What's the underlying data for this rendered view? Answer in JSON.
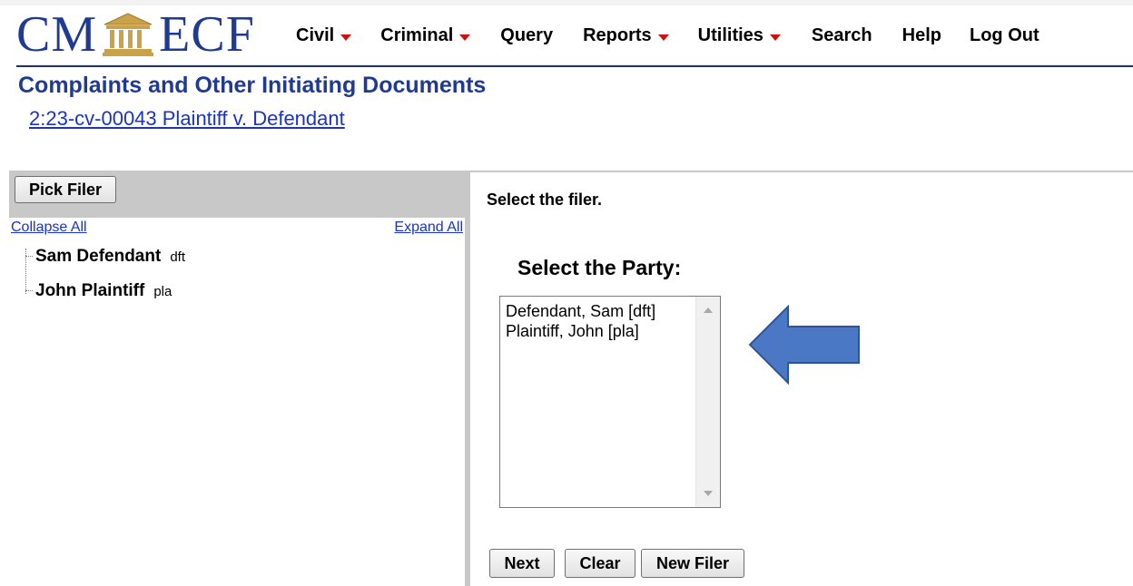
{
  "header": {
    "logo_left": "CM",
    "logo_right": "ECF",
    "menu": [
      {
        "label": "Civil",
        "has_dropdown": true
      },
      {
        "label": "Criminal",
        "has_dropdown": true
      },
      {
        "label": "Query",
        "has_dropdown": false
      },
      {
        "label": "Reports",
        "has_dropdown": true
      },
      {
        "label": "Utilities",
        "has_dropdown": true
      },
      {
        "label": "Search",
        "has_dropdown": false
      },
      {
        "label": "Help",
        "has_dropdown": false
      },
      {
        "label": "Log Out",
        "has_dropdown": false
      }
    ]
  },
  "page": {
    "title": "Complaints and Other Initiating Documents",
    "case_link": "2:23-cv-00043 Plaintiff v. Defendant"
  },
  "left_pane": {
    "pick_filer_label": "Pick Filer",
    "collapse_all": "Collapse All",
    "expand_all": "Expand All",
    "parties": [
      {
        "name": "Sam Defendant",
        "type": "dft"
      },
      {
        "name": "John Plaintiff",
        "type": "pla"
      }
    ]
  },
  "right_pane": {
    "instruction": "Select the filer.",
    "select_party_label": "Select the Party:",
    "party_options": [
      "Defendant, Sam [dft]",
      "Plaintiff, John [pla]"
    ],
    "buttons": {
      "next": "Next",
      "clear": "Clear",
      "new_filer": "New Filer"
    }
  },
  "colors": {
    "logo": "#1f3a93",
    "link": "#1a33c4",
    "caret": "#cc1111",
    "annotation_arrow": "#4a78c4",
    "pane_gray": "#c8c8c8"
  }
}
